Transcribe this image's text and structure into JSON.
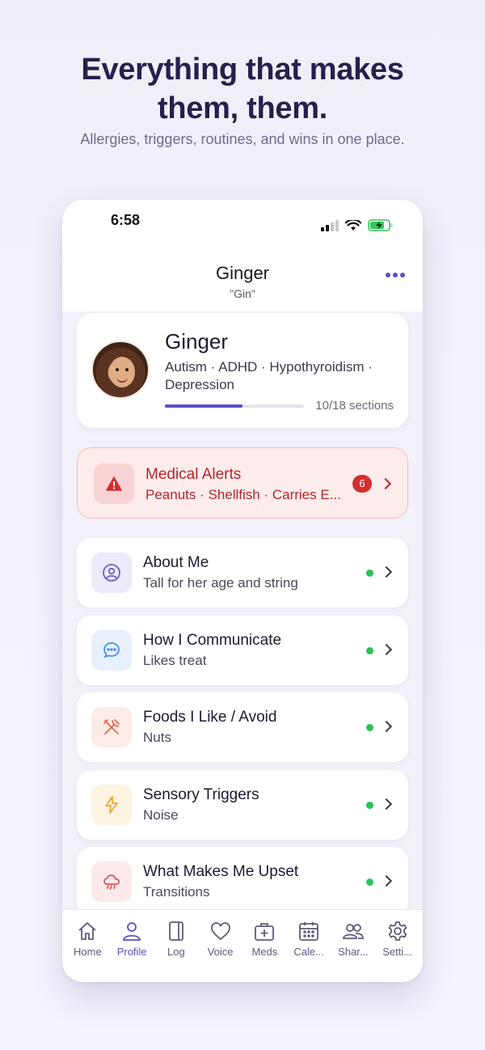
{
  "hero": {
    "headline_line1": "Everything that makes",
    "headline_line2": "them, them.",
    "subline": "Allergies, triggers, routines, and wins in one place."
  },
  "status_bar": {
    "time": "6:58"
  },
  "nav": {
    "title": "Ginger",
    "subtitle": "\"Gin\"",
    "more_icon": "ellipsis-icon"
  },
  "profile": {
    "name": "Ginger",
    "diagnoses": "Autism · ADHD · Hypothyroidism · Depression",
    "progress_text": "10/18 sections",
    "progress_fraction": 0.556
  },
  "medical_alerts": {
    "title": "Medical Alerts",
    "summary": "Peanuts · Shellfish · Carries E...",
    "count": "6",
    "icon": "warning-icon"
  },
  "sections": [
    {
      "title": "About Me",
      "subtitle": "Tall for her age and string",
      "icon": "person-circle-icon",
      "icon_bg": "#ecebfa",
      "icon_color": "#6a5ed0"
    },
    {
      "title": "How I Communicate",
      "subtitle": "Likes treat",
      "icon": "chat-bubble-icon",
      "icon_bg": "#e7f0fc",
      "icon_color": "#4a8fe0"
    },
    {
      "title": "Foods I Like / Avoid",
      "subtitle": "Nuts",
      "icon": "utensils-icon",
      "icon_bg": "#fcebe6",
      "icon_color": "#e06a4f"
    },
    {
      "title": "Sensory Triggers",
      "subtitle": "Noise",
      "icon": "lightning-icon",
      "icon_bg": "#fdf3e2",
      "icon_color": "#f0a52a"
    },
    {
      "title": "What Makes Me Upset",
      "subtitle": "Transitions",
      "icon": "storm-cloud-icon",
      "icon_bg": "#fde9ea",
      "icon_color": "#e0545d"
    }
  ],
  "tabs": [
    {
      "label": "Home",
      "icon": "home-icon"
    },
    {
      "label": "Profile",
      "icon": "person-icon",
      "active": true
    },
    {
      "label": "Log",
      "icon": "book-icon"
    },
    {
      "label": "Voice",
      "icon": "heart-icon"
    },
    {
      "label": "Meds",
      "icon": "medical-kit-icon"
    },
    {
      "label": "Cale...",
      "icon": "calendar-icon"
    },
    {
      "label": "Shar...",
      "icon": "people-icon"
    },
    {
      "label": "Setti...",
      "icon": "gear-icon"
    }
  ],
  "colors": {
    "accent": "#5b4fc7",
    "alert_red": "#b3262a",
    "status_green": "#2ec15a",
    "headline": "#25204d"
  }
}
